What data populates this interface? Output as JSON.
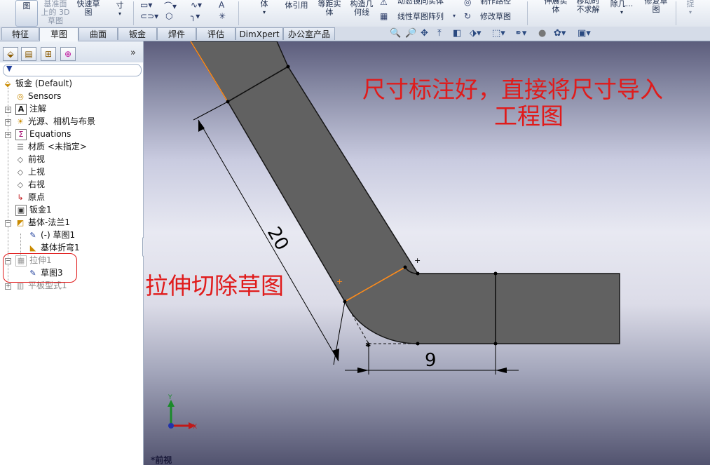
{
  "ribbon": {
    "btn_sketch": "图",
    "btn_3dsketch_line1": "基准面",
    "btn_3dsketch_line2": "上的 3D",
    "btn_3dsketch_line3": "草图",
    "btn_quick_line1": "快速草",
    "btn_quick_line2": "图",
    "btn_dim_line1": "寸",
    "btn_convert": "体引用",
    "btn_body": "体",
    "btn_offset_line1": "等距实",
    "btn_offset_line2": "体",
    "btn_construct_line1": "构造几",
    "btn_construct_line2": "何线",
    "btn_dynamic_mirror": "动态镜向实体",
    "btn_linear_pattern": "线性草图阵列",
    "btn_make_path": "制作路径",
    "btn_modify_sketch": "修改草图",
    "btn_stretch_line1": "伸展实",
    "btn_stretch_line2": "体",
    "btn_move_line1": "移动时",
    "btn_move_line2": "不求解",
    "btn_remove": "除几...",
    "btn_repair_line1": "修复草",
    "btn_repair_line2": "图",
    "btn_capture": "捉"
  },
  "tabs": [
    {
      "label": "特征",
      "active": false
    },
    {
      "label": "草图",
      "active": true
    },
    {
      "label": "曲面",
      "active": false
    },
    {
      "label": "钣金",
      "active": false
    },
    {
      "label": "焊件",
      "active": false
    },
    {
      "label": "评估",
      "active": false
    },
    {
      "label": "DimXpert",
      "active": false
    },
    {
      "label": "办公室产品",
      "active": false
    }
  ],
  "panel": {
    "expand_glyph": "»",
    "tree": [
      {
        "label": "钣金  (Default)",
        "icon": "part-icon"
      },
      {
        "label": "Sensors",
        "icon": "sensor-icon"
      },
      {
        "label": "注解",
        "icon": "annotation-icon"
      },
      {
        "label": "光源、相机与布景",
        "icon": "lights-icon"
      },
      {
        "label": "Equations",
        "icon": "equations-icon"
      },
      {
        "label": "材质 <未指定>",
        "icon": "material-icon"
      },
      {
        "label": "前视",
        "icon": "plane-icon"
      },
      {
        "label": "上视",
        "icon": "plane-icon"
      },
      {
        "label": "右视",
        "icon": "plane-icon"
      },
      {
        "label": "原点",
        "icon": "origin-icon"
      },
      {
        "label": "钣金1",
        "icon": "sheetmetal-icon"
      },
      {
        "label": "基体-法兰1",
        "icon": "base-flange-icon"
      },
      {
        "label": "(-) 草图1",
        "icon": "sketch-icon"
      },
      {
        "label": "基体折弯1",
        "icon": "bend-icon"
      },
      {
        "label": "拉伸1",
        "icon": "cut-extrude-icon"
      },
      {
        "label": "草图3",
        "icon": "sketch-icon"
      },
      {
        "label": "平板型式1",
        "icon": "flat-pattern-icon"
      }
    ]
  },
  "viewport": {
    "dim_angled": "20",
    "dim_horizontal": "9",
    "annotation_top_line1": "尺寸标注好，直接将尺寸导入",
    "annotation_top_line2": "工程图",
    "annotation_mid": "拉伸切除草图",
    "view_label": "*前视",
    "axis_x": "X",
    "axis_y": "Y"
  },
  "colors": {
    "part_fill": "#616161",
    "annotation_red": "#e01b1b",
    "highlight_orange": "#ff8c1a"
  }
}
